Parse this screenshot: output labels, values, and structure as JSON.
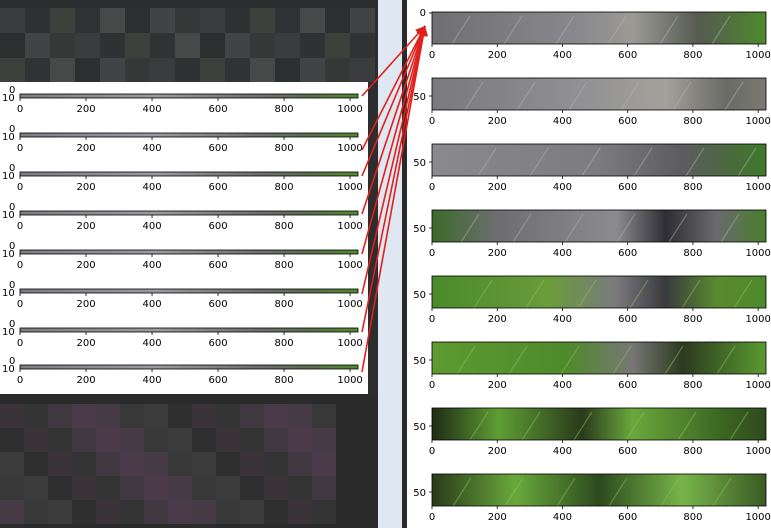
{
  "left_plot": {
    "x_tick_labels": [
      "0",
      "200",
      "400",
      "600",
      "800",
      "1000"
    ],
    "y_tick_top": "0",
    "y_tick_bottom": "10",
    "subplot_count": 8
  },
  "right_plot": {
    "x_tick_labels": [
      "0",
      "200",
      "400",
      "600",
      "800",
      "1000"
    ],
    "first_y_ticks": [
      "0",
      "50"
    ],
    "other_y_tick": "50",
    "subplot_count": 8
  },
  "annotations": {
    "arrow_color": "#e0201c",
    "arrow_count": 8
  },
  "colors": {
    "dark_panel": "#2b2d2e",
    "fur_gray": "#8a8a8c",
    "leaf_green": "#5a8f2e"
  }
}
